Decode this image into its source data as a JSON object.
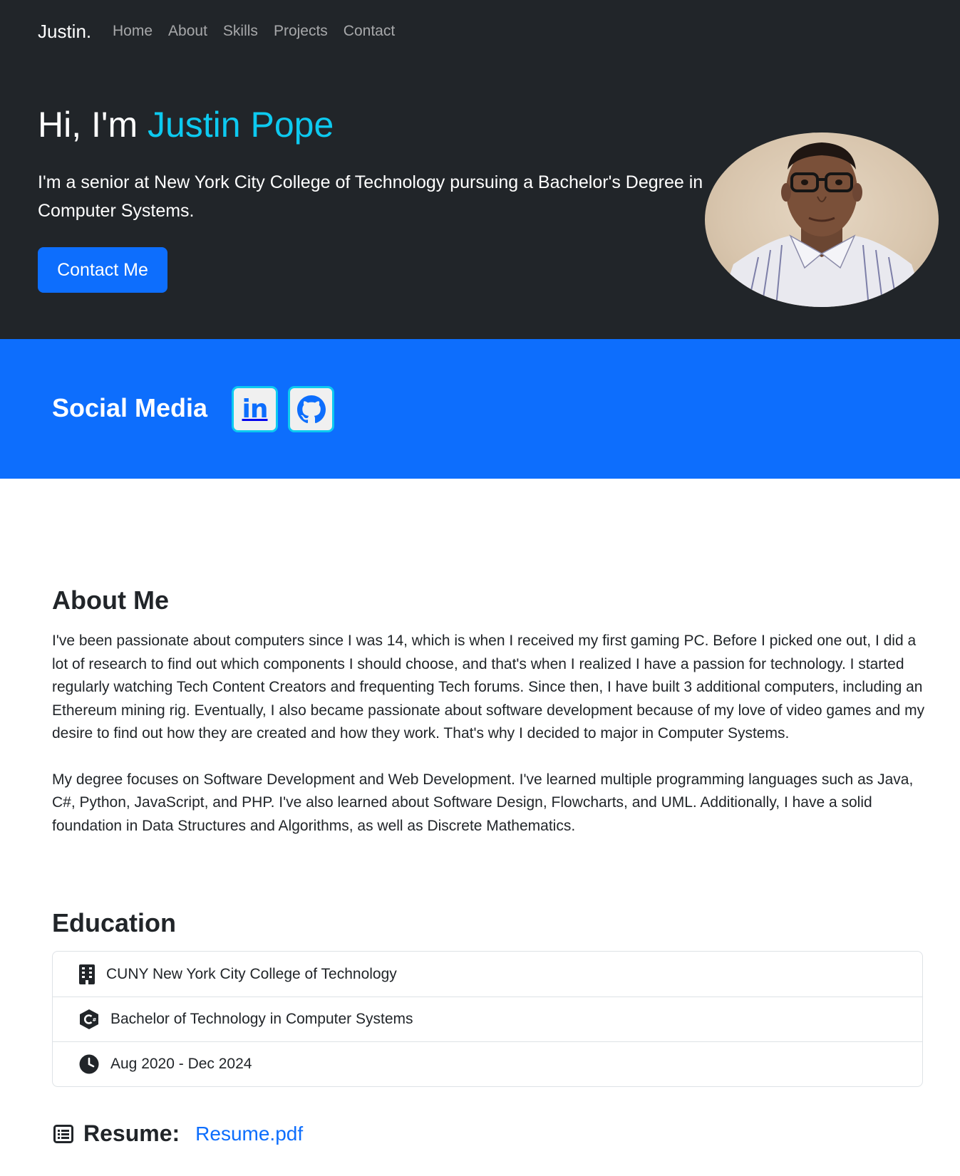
{
  "nav": {
    "brand": "Justin.",
    "links": [
      "Home",
      "About",
      "Skills",
      "Projects",
      "Contact"
    ]
  },
  "hero": {
    "greeting": "Hi, I'm ",
    "name": "Justin Pope",
    "lead": "I'm a senior at New York City College of Technology pursuing a Bachelor's Degree in Computer Systems.",
    "button": "Contact Me",
    "photo_icon": "profile-photo"
  },
  "social": {
    "title": "Social Media",
    "icons": [
      "linkedin-icon",
      "github-icon"
    ],
    "linkedin_text": "in"
  },
  "about": {
    "title": "About Me",
    "paragraphs": [
      "I've been passionate about computers since I was 14, which is when I received my first gaming PC. Before I picked one out, I did a lot of research to find out which components I should choose, and that's when I realized I have a passion for technology. I started regularly watching Tech Content Creators and frequenting Tech forums. Since then, I have built 3 additional computers, including an Ethereum mining rig. Eventually, I also became passionate about software development because of my love of video games and my desire to find out how they are created and how they work. That's why I decided to major in Computer Systems.",
      "My degree focuses on Software Development and Web Development. I've learned multiple programming languages such as Java, C#, Python, JavaScript, and PHP. I've also learned about Software Design, Flowcharts, and UML. Additionally, I have a solid foundation in Data Structures and Algorithms, as well as Discrete Mathematics."
    ]
  },
  "education": {
    "title": "Education",
    "items": [
      {
        "icon": "building-icon",
        "text": "CUNY New York City College of Technology"
      },
      {
        "icon": "csharp-icon",
        "text": "Bachelor of Technology in Computer Systems"
      },
      {
        "icon": "clock-icon",
        "text": "Aug 2020 - Dec 2024"
      }
    ]
  },
  "resume": {
    "label": "Resume:",
    "link": "Resume.pdf",
    "icon": "list-icon"
  },
  "colors": {
    "dark": "#212529",
    "primary": "#0d6efd",
    "accent": "#0dcaf0",
    "white": "#ffffff"
  }
}
